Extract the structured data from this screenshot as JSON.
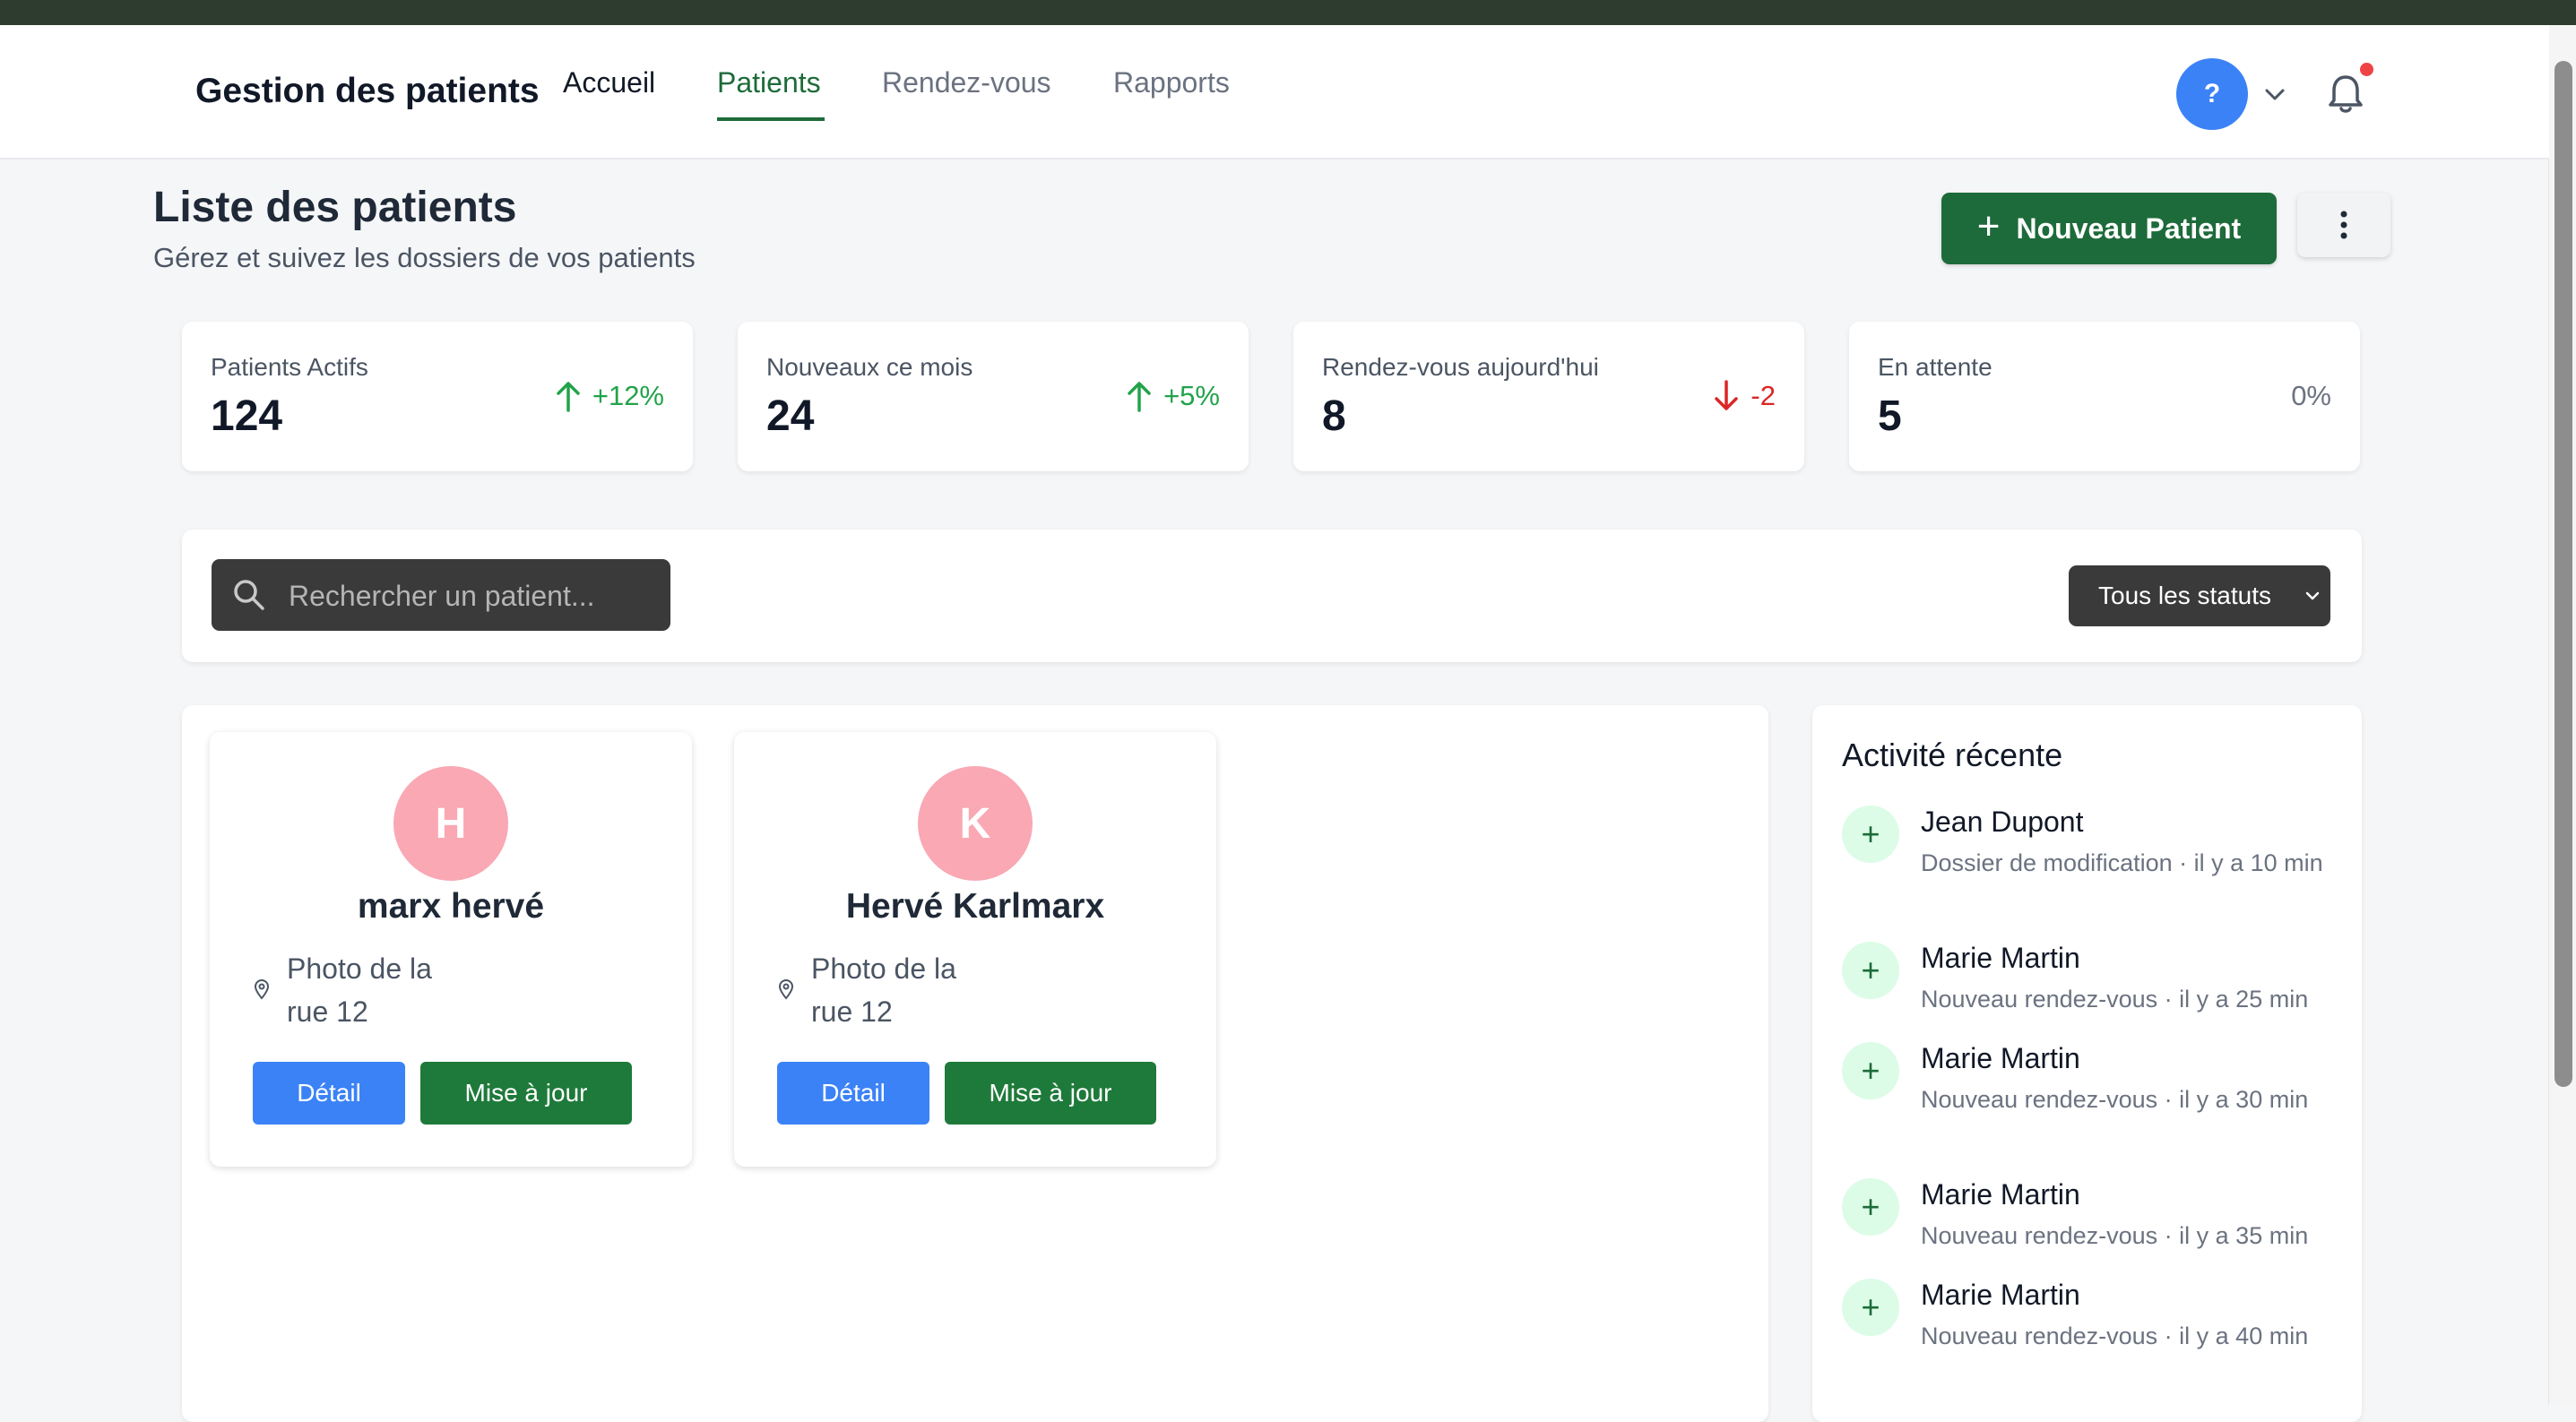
{
  "header": {
    "brand": "Gestion des patients",
    "nav": [
      "Accueil",
      "Patients",
      "Rendez-vous",
      "Rapports"
    ],
    "active_nav": "Patients",
    "avatar_label": "?"
  },
  "page": {
    "title": "Liste des patients",
    "subtitle": "Gérez et suivez les dossiers de vos patients",
    "new_patient_label": "Nouveau Patient"
  },
  "stats": [
    {
      "label": "Patients Actifs",
      "value": "124",
      "trend": "+12%",
      "direction": "up"
    },
    {
      "label": "Nouveaux ce mois",
      "value": "24",
      "trend": "+5%",
      "direction": "up"
    },
    {
      "label": "Rendez-vous aujourd'hui",
      "value": "8",
      "trend": "-2",
      "direction": "down"
    },
    {
      "label": "En attente",
      "value": "5",
      "trend": "0%",
      "direction": "flat"
    }
  ],
  "filters": {
    "search_placeholder": "Rechercher un patient...",
    "status_selected": "Tous les statuts"
  },
  "patients": [
    {
      "initial": "H",
      "name": "marx hervé",
      "address_line1": "Photo de la",
      "address_line2": "rue 12",
      "detail_label": "Détail",
      "update_label": "Mise à jour"
    },
    {
      "initial": "K",
      "name": "Hervé Karlmarx",
      "address_line1": "Photo de la",
      "address_line2": "rue 12",
      "detail_label": "Détail",
      "update_label": "Mise à jour"
    }
  ],
  "activity": {
    "title": "Activité récente",
    "items": [
      {
        "name": "Jean Dupont",
        "desc": "Dossier de modification · il y a 10 min"
      },
      {
        "name": "Marie Martin",
        "desc": "Nouveau rendez-vous · il y a 25 min"
      },
      {
        "name": "Marie Martin",
        "desc": "Nouveau rendez-vous · il y a 30 min"
      },
      {
        "name": "Marie Martin",
        "desc": "Nouveau rendez-vous · il y a 35 min"
      },
      {
        "name": "Marie Martin",
        "desc": "Nouveau rendez-vous · il y a 40 min"
      }
    ]
  },
  "colors": {
    "brand_green": "#1d6b3a",
    "detail_blue": "#3b82f6",
    "avatar_pink": "#f9a8b4",
    "trend_up": "#22a34a",
    "trend_down": "#dc2626"
  }
}
